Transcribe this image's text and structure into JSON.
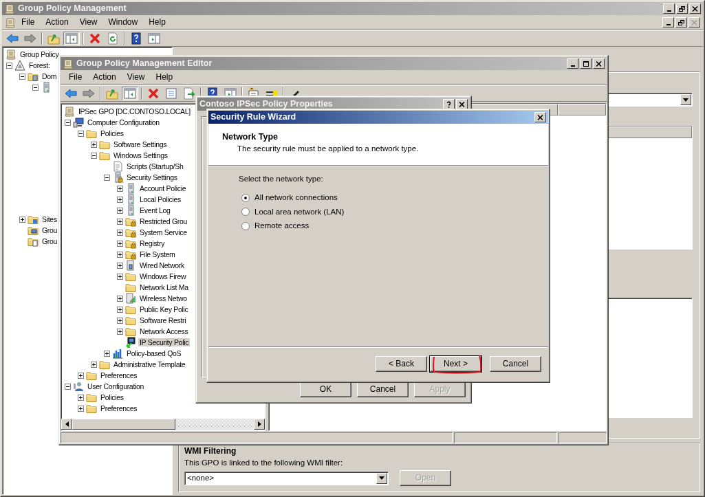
{
  "main": {
    "title": "Group Policy Management",
    "menu": [
      "File",
      "Action",
      "View",
      "Window",
      "Help"
    ],
    "tree": [
      {
        "label": "Group Policy",
        "kind": "gpo",
        "selected": false,
        "children": [
          {
            "label": "Forest:",
            "kind": "forest",
            "expanded": true,
            "selected": false,
            "children": [
              {
                "label": "Dom",
                "kind": "domain",
                "expanded": true,
                "selected": false,
                "children": [
                  {
                    "kind": "server",
                    "expanded": true,
                    "selected": false
                  }
                ]
              },
              {
                "label": "Sites",
                "kind": "sites",
                "expanded": false,
                "selected": false
              },
              {
                "label": "Grou",
                "kind": "computers",
                "selected": false
              },
              {
                "label": "Grou",
                "kind": "gpo-folder",
                "selected": false
              }
            ]
          }
        ]
      }
    ],
    "wmi": {
      "heading": "WMI Filtering",
      "label": "This GPO is linked to the following WMI filter:",
      "value": "<none>",
      "button": {
        "label": "Open",
        "disabled": true
      }
    }
  },
  "editor": {
    "title": "Group Policy Management Editor",
    "menu": [
      "File",
      "Action",
      "View",
      "Help"
    ],
    "tree": [
      {
        "label": "IPSec GPO [DC.CONTOSO.LOCAL]",
        "kind": "gpo",
        "selected": false,
        "children": [
          {
            "label": "Computer Configuration",
            "kind": "computer",
            "expanded": true,
            "selected": false,
            "children": [
              {
                "label": "Policies",
                "kind": "folder",
                "expanded": true,
                "selected": false,
                "children": [
                  {
                    "label": "Software Settings",
                    "kind": "folder",
                    "expanded": false,
                    "selected": false
                  },
                  {
                    "label": "Windows Settings",
                    "kind": "folder",
                    "expanded": true,
                    "selected": false,
                    "children": [
                      {
                        "label": "Scripts (Startup/Sh",
                        "kind": "script",
                        "selected": false
                      },
                      {
                        "label": "Security Settings",
                        "kind": "security",
                        "expanded": true,
                        "selected": false,
                        "children": [
                          {
                            "label": "Account Policie",
                            "kind": "server",
                            "expanded": false,
                            "selected": false
                          },
                          {
                            "label": "Local Policies",
                            "kind": "server",
                            "expanded": false,
                            "selected": false
                          },
                          {
                            "label": "Event Log",
                            "kind": "server",
                            "expanded": false,
                            "selected": false
                          },
                          {
                            "label": "Restricted Grou",
                            "kind": "secure-folder",
                            "expanded": false,
                            "selected": false
                          },
                          {
                            "label": "System Service",
                            "kind": "secure-folder",
                            "expanded": false,
                            "selected": false
                          },
                          {
                            "label": "Registry",
                            "kind": "secure-folder",
                            "expanded": false,
                            "selected": false
                          },
                          {
                            "label": "File System",
                            "kind": "secure-folder",
                            "expanded": false,
                            "selected": false
                          },
                          {
                            "label": "Wired Network",
                            "kind": "network",
                            "expanded": false,
                            "selected": false
                          },
                          {
                            "label": "Windows Firew",
                            "kind": "folder",
                            "expanded": false,
                            "selected": false
                          },
                          {
                            "label": "Network List Ma",
                            "kind": "folder",
                            "selected": false
                          },
                          {
                            "label": "Wireless Netwo",
                            "kind": "wireless",
                            "expanded": false,
                            "selected": false
                          },
                          {
                            "label": "Public Key Polic",
                            "kind": "folder",
                            "expanded": false,
                            "selected": false
                          },
                          {
                            "label": "Software Restri",
                            "kind": "folder",
                            "expanded": false,
                            "selected": false
                          },
                          {
                            "label": "Network Access",
                            "kind": "folder",
                            "expanded": false,
                            "selected": false
                          },
                          {
                            "label": "IP Security Polic",
                            "kind": "ipsec",
                            "selected": true
                          }
                        ]
                      },
                      {
                        "label": "Policy-based QoS",
                        "kind": "chart",
                        "expanded": false,
                        "selected": false
                      }
                    ]
                  },
                  {
                    "label": "Administrative Template",
                    "kind": "folder",
                    "expanded": false,
                    "selected": false
                  }
                ]
              },
              {
                "label": "Preferences",
                "kind": "folder",
                "expanded": false,
                "selected": false
              }
            ]
          },
          {
            "label": "User Configuration",
            "kind": "user",
            "expanded": true,
            "selected": false,
            "children": [
              {
                "label": "Policies",
                "kind": "folder",
                "expanded": false,
                "selected": false
              },
              {
                "label": "Preferences",
                "kind": "folder",
                "expanded": false,
                "selected": false
              }
            ]
          }
        ]
      }
    ]
  },
  "properties": {
    "title": "Contoso IPSec Policy Properties",
    "buttons": [
      {
        "label": "OK",
        "disabled": false
      },
      {
        "label": "Cancel",
        "disabled": false
      },
      {
        "label": "Apply",
        "disabled": true
      }
    ]
  },
  "wizard": {
    "title": "Security Rule Wizard",
    "heading": "Network Type",
    "subtitle": "The security rule must be applied to a network type.",
    "prompt": "Select the network type:",
    "options": [
      {
        "label": "All network connections",
        "selected": true
      },
      {
        "label": "Local area network (LAN)",
        "selected": false
      },
      {
        "label": "Remote access",
        "selected": false
      }
    ],
    "buttons": [
      {
        "label": "< Back",
        "default": false,
        "highlighted": false
      },
      {
        "label": "Next >",
        "default": true,
        "highlighted": true
      },
      {
        "label": "Cancel",
        "default": false,
        "highlighted": false
      }
    ]
  }
}
